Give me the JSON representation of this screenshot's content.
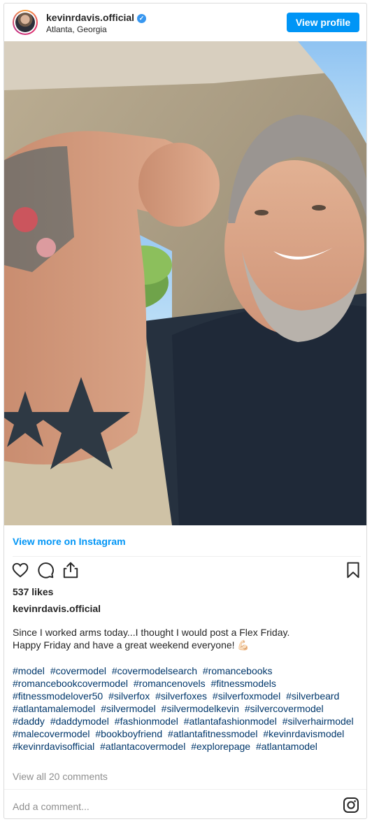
{
  "header": {
    "username": "kevinrdavis.official",
    "verified_icon": "verified-badge-icon",
    "location": "Atlanta, Georgia",
    "view_profile_label": "View profile"
  },
  "post": {
    "photo": "selfie-in-car-flexing-arm",
    "view_more_label": "View more on Instagram",
    "likes": "537 likes",
    "owner": "kevinrdavis.official",
    "caption_line1": "Since I worked arms today...I thought I would post a Flex Friday.",
    "caption_line2": "Happy Friday and have a great weekend everyone! 💪🏻",
    "hashtags": [
      "#model",
      "#covermodel",
      "#covermodelsearch",
      "#romancebooks",
      "#romancebookcovermodel",
      "#romancenovels",
      "#fitnessmodels",
      "#fitnessmodelover50",
      "#silverfox",
      "#silverfoxes",
      "#silverfoxmodel",
      "#silverbeard",
      "#atlantamalemodel",
      "#silvermodel",
      "#silvermodelkevin",
      "#silvercovermodel",
      "#daddy",
      "#daddymodel",
      "#fashionmodel",
      "#atlantafashionmodel",
      "#silverhairmodel",
      "#malecovermodel",
      "#bookboyfriend",
      "#atlantafitnessmodel",
      "#kevinrdavismodel",
      "#kevinrdavisofficial",
      "#atlantacovermodel",
      "#explorepage",
      "#atlantamodel"
    ],
    "view_comments_label": "View all 20 comments",
    "comment_placeholder": "Add a comment..."
  },
  "colors": {
    "accent": "#0095f6",
    "hashtag": "#00376b",
    "muted": "#8e8e8e"
  }
}
